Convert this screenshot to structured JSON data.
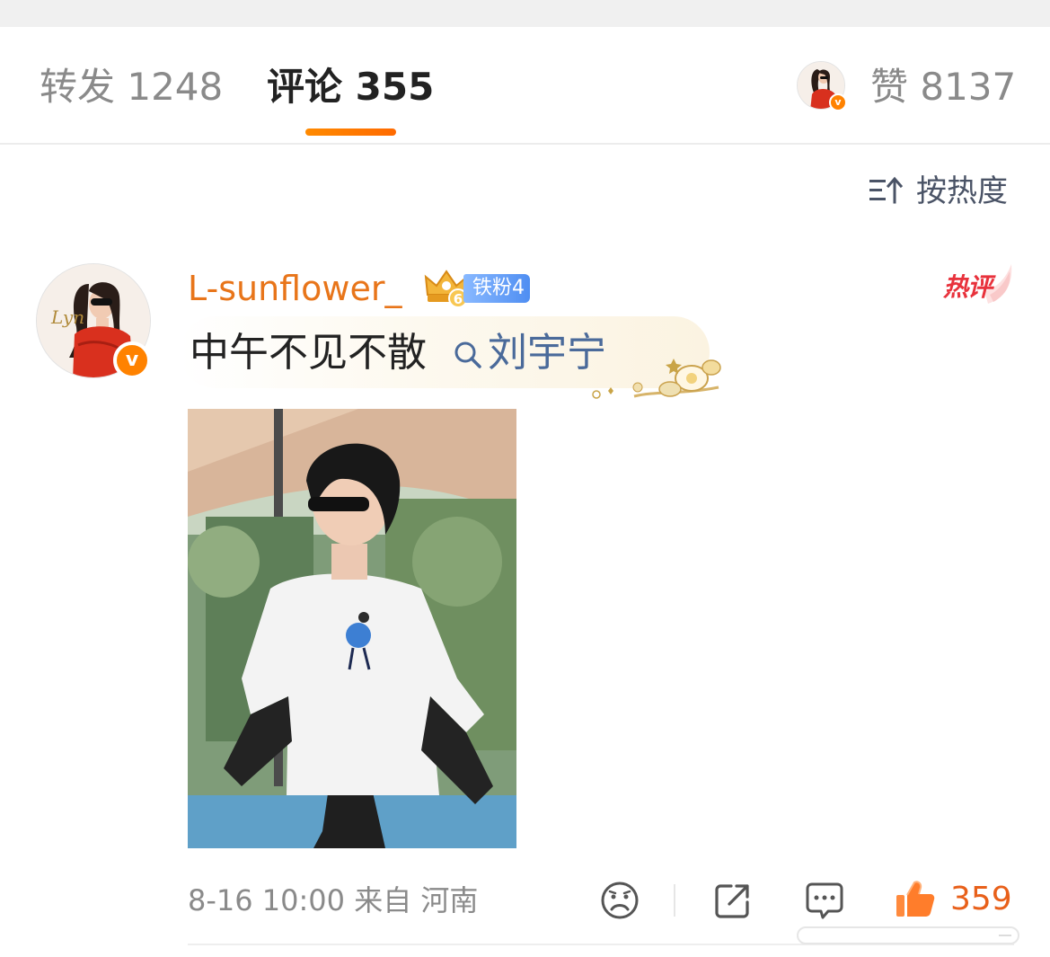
{
  "tabs": {
    "repost": "转发 1248",
    "comment": "评论 355",
    "likes": "赞 8137"
  },
  "sort": {
    "label": "按热度"
  },
  "comment": {
    "username": "L-sunflower_",
    "crown_level": "6",
    "fan_badge": "铁粉4",
    "hot_label": "热评",
    "text": "中午不见不散",
    "topic": "刘宇宁",
    "avatar_signature": "Lyn",
    "meta": "8-16 10:00 来自 河南",
    "like_count": "359"
  },
  "icons": {
    "sort": "sort-icon",
    "search": "search-icon",
    "dislike": "sad-face-icon",
    "share": "share-icon",
    "comment": "comment-bubble-icon",
    "like": "thumbs-up-icon",
    "verified": "verified-v-icon"
  },
  "colors": {
    "accent_orange": "#ff8200",
    "username": "#e8751a",
    "like": "#e8601a",
    "hot_red": "#e8323c",
    "topic_blue": "#4a6a9a",
    "fan_badge_blue": "#5b95f0"
  }
}
